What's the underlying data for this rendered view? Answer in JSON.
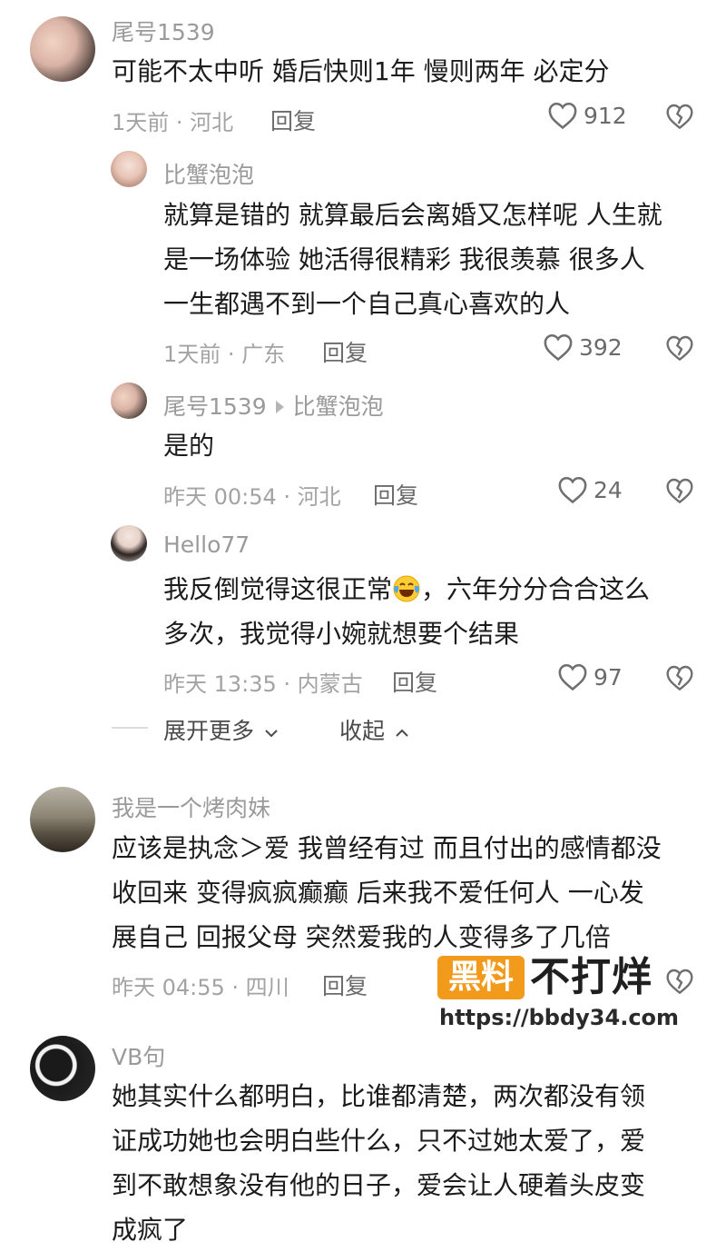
{
  "comments": [
    {
      "user": "尾号1539",
      "lines": [
        "可能不太中听 婚后快则1年 慢则两年 必定分"
      ],
      "meta": "1天前 · 河北",
      "reply": "回复",
      "likes": "912",
      "replies": [
        {
          "user": "比蟹泡泡",
          "lines": [
            "就算是错的 就算最后会离婚又怎样呢 人生就",
            "是一场体验 她活得很精彩 我很羡慕 很多人",
            "一生都遇不到一个自己真心喜欢的人"
          ],
          "meta": "1天前 · 广东",
          "reply": "回复",
          "likes": "392"
        },
        {
          "user": "尾号1539",
          "reply_to": "比蟹泡泡",
          "lines": [
            "是的"
          ],
          "meta": "昨天 00:54 · 河北",
          "reply": "回复",
          "likes": "24"
        },
        {
          "user": "Hello77",
          "line1_a": "我反倒觉得这很正常",
          "line1_b": "，六年分分合合这么",
          "lines": [
            "多次，我觉得小婉就想要个结果"
          ],
          "meta": "昨天 13:35 · 内蒙古",
          "reply": "回复",
          "likes": "97"
        }
      ],
      "expand_label": "展开更多",
      "collapse_label": "收起"
    },
    {
      "user": "我是一个烤肉妹",
      "lines": [
        "应该是执念＞爱 我曾经有过 而且付出的感情都没",
        "收回来 变得疯疯癫癫 后来我不爱任何人 一心发",
        "展自己 回报父母 突然爱我的人变得多了几倍"
      ],
      "meta": "昨天 04:55 · 四川",
      "reply": "回复"
    },
    {
      "user": "VB句",
      "lines": [
        "她其实什么都明白，比谁都清楚，两次都没有领",
        "证成功她也会明白些什么，只不过她太爱了，爱",
        "到不敢想象没有他的日子，爱会让人硬着头皮变",
        "成疯了"
      ]
    }
  ],
  "watermark": {
    "badge": "黑料",
    "title": "不打烊",
    "url": "https://bbdy34.com"
  }
}
